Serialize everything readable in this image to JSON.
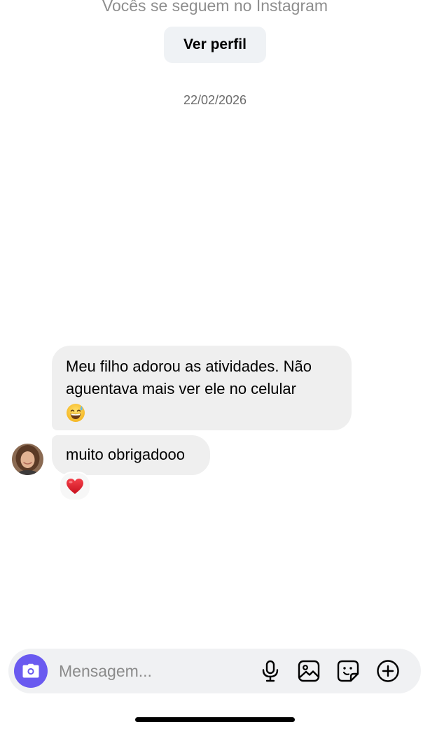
{
  "header": {
    "follow_note": "Vocês se seguem no Instagram",
    "view_profile_label": "Ver perfil"
  },
  "thread": {
    "date_separator": "22/02/2026",
    "messages": [
      {
        "text": "Meu filho adorou as atividades. Não aguentava mais ver ele no celular",
        "emoji": "grinning-sweat-emoji"
      },
      {
        "text": "muito obrigadooo",
        "reaction": "red-heart-emoji"
      }
    ]
  },
  "composer": {
    "placeholder": "Mensagem...",
    "value": "",
    "icons": [
      "camera-icon",
      "microphone-icon",
      "gallery-icon",
      "sticker-icon",
      "add-icon"
    ]
  },
  "colors": {
    "camera_button": "#6a5af0",
    "bubble": "#efefef",
    "profile_button": "#eff2f5",
    "composer": "#f0f1f3"
  }
}
